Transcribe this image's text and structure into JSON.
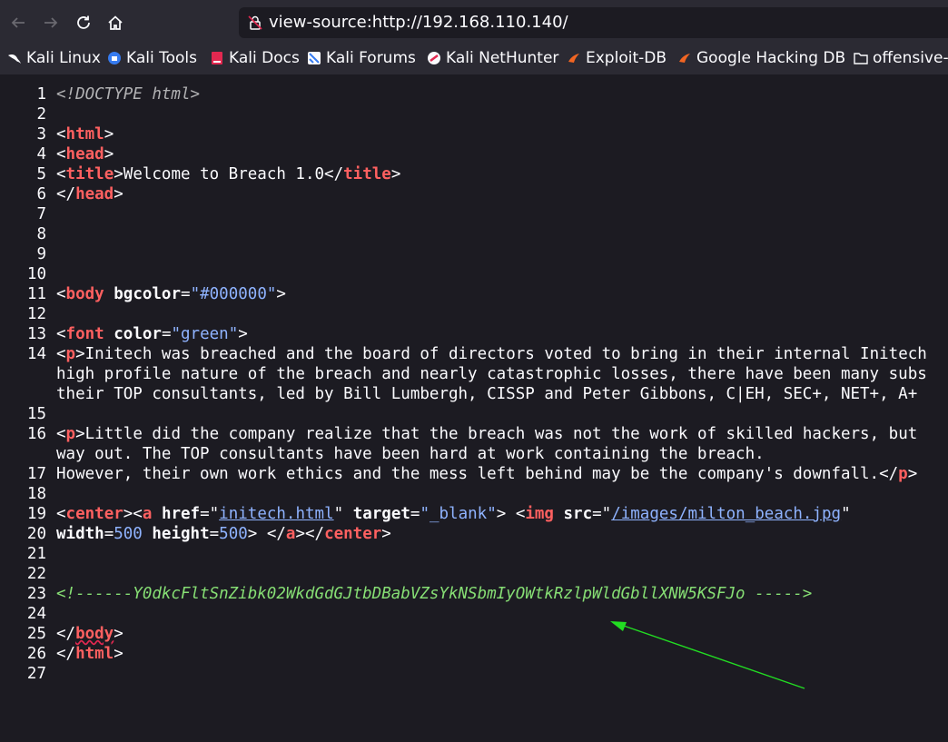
{
  "browser": {
    "url": "view-source:http://192.168.110.140/",
    "bookmarks": [
      {
        "label": "Kali Linux",
        "icon": "kali-dragon-icon"
      },
      {
        "label": "Kali Tools",
        "icon": "kali-tools-icon"
      },
      {
        "label": "Kali Docs",
        "icon": "kali-docs-icon"
      },
      {
        "label": "Kali Forums",
        "icon": "kali-forums-icon"
      },
      {
        "label": "Kali NetHunter",
        "icon": "kali-nethunter-icon"
      },
      {
        "label": "Exploit-DB",
        "icon": "exploit-db-icon"
      },
      {
        "label": "Google Hacking DB",
        "icon": "ghdb-icon"
      },
      {
        "label": "offensive-",
        "icon": "folder-icon"
      }
    ]
  },
  "source": {
    "line_numbers": [
      "1",
      "2",
      "3",
      "4",
      "5",
      "6",
      "7",
      "8",
      "9",
      "10",
      "11",
      "12",
      "13",
      "14",
      "",
      "",
      "15",
      "16",
      "",
      "17",
      "18",
      "19",
      "20",
      "21",
      "22",
      "23",
      "24",
      "25",
      "26",
      "27"
    ],
    "l1": "<!DOCTYPE html>",
    "l3_tag": "html",
    "l4_tag": "head",
    "l5_tag": "title",
    "l5_text": "Welcome to Breach 1.0",
    "l6_tag": "head",
    "l11_tag": "body",
    "l11_attr": "bgcolor",
    "l11_val": "\"#000000\"",
    "l13_tag": "font",
    "l13_attr": "color",
    "l13_val": "\"green\"",
    "l14_tag": "p",
    "l14_text": "Initech was breached and the board of directors voted to bring in their internal Initech",
    "l14_cont1": "high profile nature of the breach and nearly catastrophic losses, there have been many subs",
    "l14_cont2": "their TOP consultants, led by Bill Lumbergh, CISSP and Peter Gibbons, C|EH, SEC+, NET+, A+",
    "l16_tag": "p",
    "l16_text": "Little did the company realize that the breach was not the work of skilled hackers, but",
    "l16_cont": "way out. The TOP consultants have been hard at work containing the breach.",
    "l17_text": "However, their own work ethics and the mess left behind may be the company's downfall.",
    "l17_tag": "p",
    "l19_tag_center": "center",
    "l19_tag_a": "a",
    "l19_attr_href": "href",
    "l19_href": "initech.html",
    "l19_attr_target": "target",
    "l19_target": "\"_blank\"",
    "l19_tag_img": "img",
    "l19_attr_src": "src",
    "l19_src": "/images/milton_beach.jpg",
    "l20_attr_w": "width",
    "l20_w": "500",
    "l20_attr_h": "height",
    "l20_h": "500",
    "l20_tag_a": "a",
    "l20_tag_center": "center",
    "l23_comment": "<!------Y0dkcFltSnZibk02WkdGdGJtbDBabVZsYkNSbmIyOWtkRzlpWldGbllXNW5KSFJo ----->",
    "l25_tag": "body",
    "l26_tag": "html"
  },
  "colors": {
    "chrome_bg": "#2b2a33",
    "page_bg": "#1c1b22",
    "tag": "#ff6060",
    "value": "#8fb3ff",
    "comment": "#86de74",
    "arrow": "#22dd22"
  }
}
